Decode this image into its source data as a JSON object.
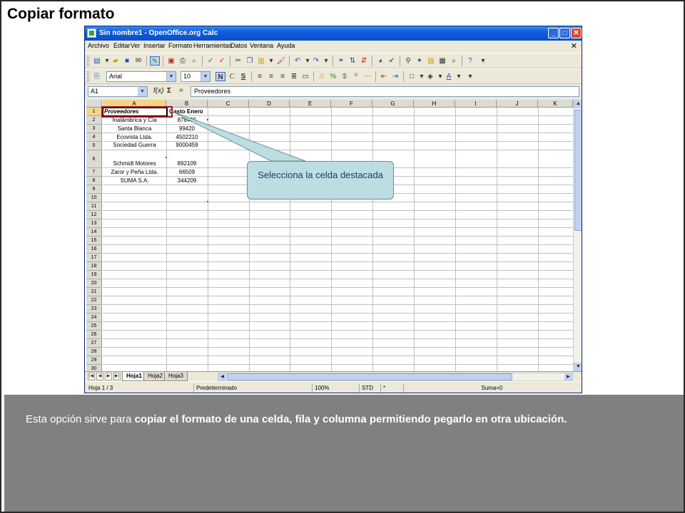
{
  "slide": {
    "title": "Copiar formato",
    "description_prefix": "Esta opción sirve para ",
    "description_bold": "copiar el formato de una celda, fila y columna permitiendo pegarlo en otra ubicación."
  },
  "window": {
    "title": "Sin nombre1 - OpenOffice.org Calc",
    "controls": {
      "minimize": "_",
      "maximize": "□",
      "close": "✕"
    }
  },
  "menu": {
    "items": [
      "Archivo",
      "Editar",
      "Ver",
      "Insertar",
      "Formato",
      "Herramientas",
      "Datos",
      "Ventana",
      "Ayuda"
    ],
    "doc_close": "✕"
  },
  "format_toolbar": {
    "font_name": "Arial",
    "font_size": "10",
    "bold": "N",
    "italic": "C",
    "underline": "S"
  },
  "formula_bar": {
    "name_box": "A1",
    "function_icon": "f(x)",
    "sum_icon": "Σ",
    "equals_icon": "=",
    "content": "Proveedores"
  },
  "sheet": {
    "columns": [
      "A",
      "B",
      "C",
      "D",
      "E",
      "F",
      "G",
      "H",
      "I",
      "J",
      "K"
    ],
    "rows": [
      "1",
      "2",
      "3",
      "4",
      "5",
      "6",
      "7",
      "8",
      "9",
      "10",
      "11",
      "12",
      "13",
      "14",
      "15",
      "16",
      "17",
      "18",
      "19",
      "20",
      "21",
      "22",
      "23",
      "24",
      "25",
      "26",
      "27",
      "28",
      "29",
      "30"
    ],
    "cells": {
      "a1": "Proveedores",
      "b1": "Gasto Enero",
      "a2": "Inalámbrica y Cía",
      "b2": "878455",
      "a3": "Santa Blanca",
      "b3": "99420",
      "a4": "Ecovista Ltda.",
      "b4": "4502210",
      "a5": "Sociedad Guerra",
      "b5": "9000459",
      "a6": "Schmidt Motores",
      "b6": "892109",
      "a7": "Zaror y Peña Ltda.",
      "b7": "66509",
      "a8": "SUMA S.A.",
      "b8": "344209"
    }
  },
  "sheet_tabs": [
    "Hoja1",
    "Hoja2",
    "Hoja3"
  ],
  "status_bar": {
    "page": "Hoja 1 / 3",
    "style": "Predeterminado",
    "zoom": "100%",
    "mode": "STD",
    "modified": "*",
    "sum": "Suma=0"
  },
  "callout": {
    "text": "Selecciona la celda destacada"
  },
  "colors": {
    "highlight_border": "#a5151c",
    "callout_fill": "#bcdde2",
    "panel_fill": "#808080",
    "titlebar": "#0b4fc9"
  }
}
